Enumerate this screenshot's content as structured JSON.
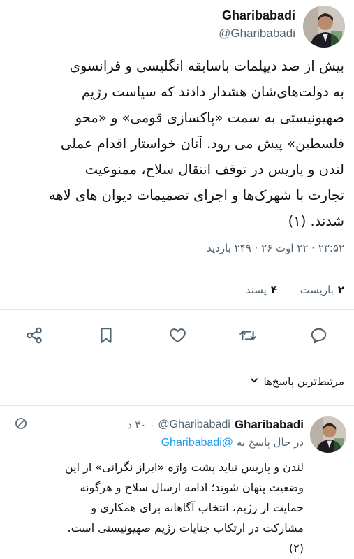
{
  "main_tweet": {
    "display_name": "Gharibabadi",
    "handle": "@Gharibabadi",
    "lines": [
      "بیش از صد دیپلمات باسابقه انگلیسی و فرانسوی",
      "به دولت‌های‌شان هشدار دادند که سیاست رژیم",
      "صهیونیستی به سمت «پاکسازی قومی» و «محو",
      "فلسطین» پیش می رود. آنان خواستار اقدام عملی",
      "لندن و پاریس در توقف انتقال سلاح، ممنوعیت",
      "تجارت با شهرک‌ها و اجرای تصمیمات دیوان های لاهه",
      "شدند. (۱)"
    ],
    "meta": "۲۳:۵۲ · ۲۲ اوت ۲۶ · ۲۴۹ بازدید"
  },
  "stats": {
    "retweets_count": "۲",
    "retweets_label": "بازیست",
    "likes_count": "۴",
    "likes_label": "پسند"
  },
  "actions": {
    "share_icon": "share-icon",
    "bookmark_icon": "bookmark-icon",
    "like_icon": "heart-icon",
    "retweet_icon": "retweet-icon",
    "reply_icon": "comment-icon"
  },
  "sort": {
    "label": "مرتبط‌ترین پاسخ‌ها"
  },
  "reply_tweet": {
    "display_name": "Gharibabadi",
    "handle": "@Gharibabadi",
    "time": "۴۰ د",
    "replying_to_label": "در حال پاسخ به",
    "replying_to_handle": "@Gharibabadi",
    "lines": [
      "لندن و پاریس نباید پشت واژه «ابراز نگرانی» از این",
      "وضعیت پنهان شوند؛ ادامه ارسال سلاح و هرگونه",
      "حمایت از رژیم، انتخاب آگاهانه برای همکاری و",
      "مشارکت در ارتکاب جنایات رژیم صهیونیستی است.",
      "(۲)"
    ]
  }
}
